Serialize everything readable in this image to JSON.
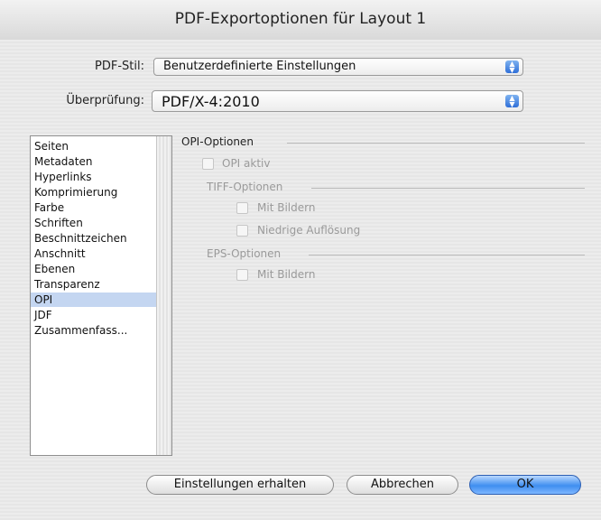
{
  "window": {
    "title": "PDF-Exportoptionen für Layout 1"
  },
  "pdf_stil": {
    "label": "PDF-Stil:",
    "value": "Benutzerdefinierte Einstellungen"
  },
  "ueberpruefung": {
    "label": "Überprüfung:",
    "value": "PDF/X-4:2010"
  },
  "sidebar": {
    "items": [
      "Seiten",
      "Metadaten",
      "Hyperlinks",
      "Komprimierung",
      "Farbe",
      "Schriften",
      "Beschnittzeichen",
      "Anschnitt",
      "Ebenen",
      "Transparenz",
      "OPI",
      "JDF",
      "Zusammenfass..."
    ],
    "selected": "OPI"
  },
  "opi": {
    "section_title": "OPI-Optionen",
    "opi_aktiv": "OPI aktiv",
    "tiff_title": "TIFF-Optionen",
    "tiff_mit_bildern": "Mit Bildern",
    "tiff_niedrige": "Niedrige Auflösung",
    "eps_title": "EPS-Optionen",
    "eps_mit_bildern": "Mit Bildern"
  },
  "buttons": {
    "keep": "Einstellungen erhalten",
    "cancel": "Abbrechen",
    "ok": "OK"
  }
}
